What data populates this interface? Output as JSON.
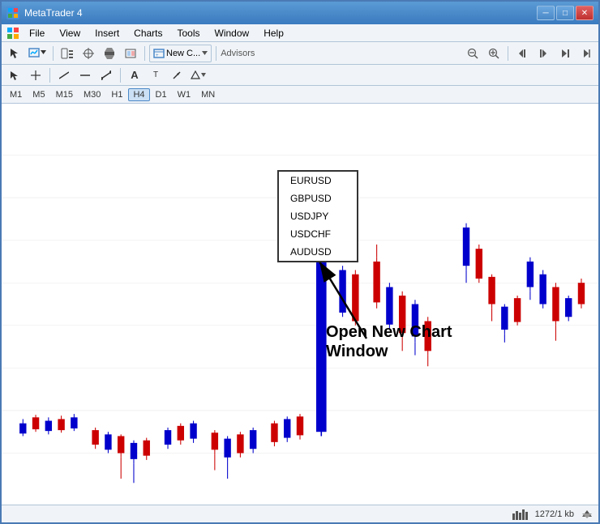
{
  "window": {
    "title": "MetaTrader 4",
    "icon": "MT4"
  },
  "window_controls": {
    "minimize": "─",
    "maximize": "□",
    "close": "✕"
  },
  "menu": {
    "items": [
      "File",
      "View",
      "Insert",
      "Charts",
      "Tools",
      "Window",
      "Help"
    ]
  },
  "toolbar": {
    "new_label": "New C...",
    "advisors_label": "Advisors"
  },
  "timeframe": {
    "buttons": [
      "M1",
      "M5",
      "M15",
      "M30",
      "H1",
      "H4",
      "D1",
      "W1",
      "MN"
    ]
  },
  "dropdown": {
    "items": [
      "EURUSD",
      "GBPUSD",
      "USDJPY",
      "USDCHF",
      "AUDUSD"
    ]
  },
  "annotation": {
    "label_line1": "Open New Chart",
    "label_line2": "Window"
  },
  "status_bar": {
    "right_text": "1272/1 kb"
  }
}
